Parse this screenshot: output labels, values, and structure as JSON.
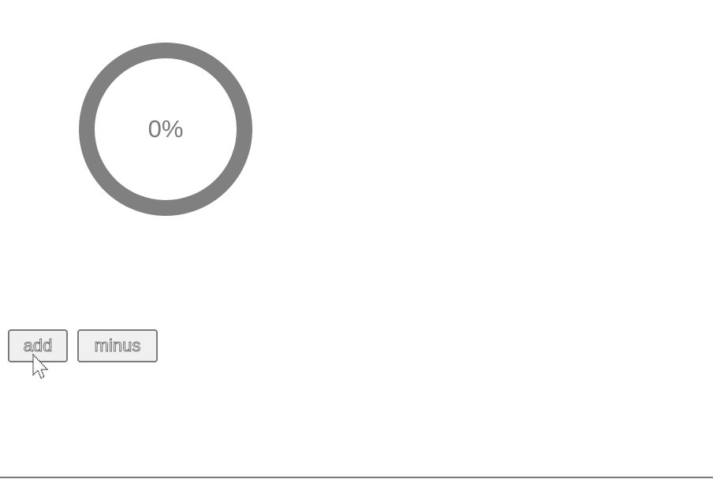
{
  "progress": {
    "label": "0%",
    "value_percent": 0,
    "track_color": "#808080",
    "fill_color": "#4a90d9"
  },
  "controls": {
    "add_label": "add",
    "minus_label": "minus"
  },
  "cursor": {
    "icon": "arrow-pointer-icon"
  }
}
